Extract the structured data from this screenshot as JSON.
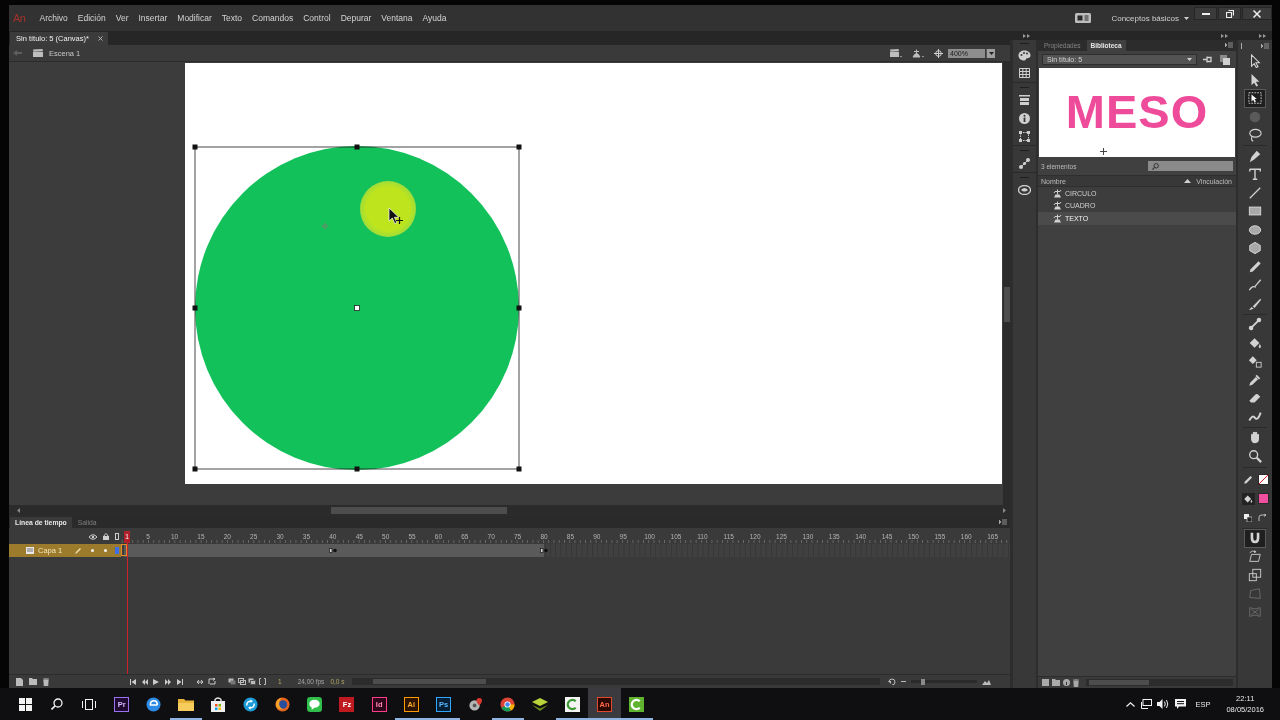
{
  "app": {
    "logo": "An"
  },
  "menu_bar": {
    "items": [
      "Archivo",
      "Edición",
      "Ver",
      "Insertar",
      "Modificar",
      "Texto",
      "Comandos",
      "Control",
      "Depurar",
      "Ventana",
      "Ayuda"
    ],
    "workspace": "Conceptos básicos"
  },
  "document_tabs": [
    {
      "label": "Sin título: 5 (Canvas)*",
      "selected": true
    }
  ],
  "edit_bar": {
    "scene": "Escena 1",
    "zoom": "400%"
  },
  "timeline": {
    "tabs": [
      {
        "label": "Línea de tiempo",
        "selected": true
      },
      {
        "label": "Salida",
        "selected": false
      }
    ],
    "frames": [
      {
        "label": "1",
        "selected": true,
        "keyframe": false
      },
      {
        "label": "5",
        "selected": false,
        "keyframe": false
      },
      {
        "label": "10",
        "selected": false,
        "keyframe": false
      },
      {
        "label": "15",
        "selected": false,
        "keyframe": false
      },
      {
        "label": "20",
        "selected": false,
        "keyframe": false
      },
      {
        "label": "25",
        "selected": false,
        "keyframe": false
      },
      {
        "label": "30",
        "selected": false,
        "keyframe": false
      },
      {
        "label": "35",
        "selected": false,
        "keyframe": false
      },
      {
        "label": "40",
        "selected": false,
        "keyframe": true
      },
      {
        "label": "45",
        "selected": false,
        "keyframe": false
      },
      {
        "label": "50",
        "selected": false,
        "keyframe": false
      },
      {
        "label": "55",
        "selected": false,
        "keyframe": false
      },
      {
        "label": "60",
        "selected": false,
        "keyframe": false
      },
      {
        "label": "65",
        "selected": false,
        "keyframe": false
      },
      {
        "label": "70",
        "selected": false,
        "keyframe": false
      },
      {
        "label": "75",
        "selected": false,
        "keyframe": false
      },
      {
        "label": "80",
        "selected": false,
        "keyframe": true
      },
      {
        "label": "85",
        "selected": false,
        "keyframe": false
      },
      {
        "label": "90",
        "selected": false,
        "keyframe": false
      },
      {
        "label": "95",
        "selected": false,
        "keyframe": false
      },
      {
        "label": "100",
        "selected": false,
        "keyframe": false
      },
      {
        "label": "105",
        "selected": false,
        "keyframe": false
      },
      {
        "label": "110",
        "selected": false,
        "keyframe": false
      },
      {
        "label": "115",
        "selected": false,
        "keyframe": false
      },
      {
        "label": "120",
        "selected": false,
        "keyframe": false
      },
      {
        "label": "125",
        "selected": false,
        "keyframe": false
      },
      {
        "label": "130",
        "selected": false,
        "keyframe": false
      },
      {
        "label": "135",
        "selected": false,
        "keyframe": false
      },
      {
        "label": "140",
        "selected": false,
        "keyframe": false
      },
      {
        "label": "145",
        "selected": false,
        "keyframe": false
      },
      {
        "label": "150",
        "selected": false,
        "keyframe": false
      },
      {
        "label": "155",
        "selected": false,
        "keyframe": false
      },
      {
        "label": "160",
        "selected": false,
        "keyframe": false
      },
      {
        "label": "165",
        "selected": false,
        "keyframe": false
      }
    ],
    "layers": [
      {
        "name": "Capa 1",
        "selected": true,
        "visible": true,
        "locked": false,
        "color": "#3f6fe8"
      }
    ],
    "footer": {
      "frame": "1",
      "fps": "24,00 fps",
      "time": "0,0 s"
    }
  },
  "library_panel": {
    "tabs": [
      {
        "label": "Propiedades",
        "selected": false
      },
      {
        "label": "Biblioteca",
        "selected": true
      }
    ],
    "library": "Sin título: 5",
    "preview_text": "MESO",
    "count": "3 elementos",
    "columns": [
      "Nombre",
      "Vinculación"
    ],
    "items": [
      {
        "name": "CIRCULO",
        "selected": false
      },
      {
        "name": "CUADRO",
        "selected": false
      },
      {
        "name": "TEXTO",
        "selected": true
      }
    ]
  },
  "tools": {
    "groups": [
      {
        "items": [
          {
            "kind": "selection",
            "selected": false,
            "disabled": false
          },
          {
            "kind": "subselection",
            "selected": false,
            "disabled": false
          },
          {
            "kind": "free-transform",
            "selected": true,
            "disabled": false
          },
          {
            "kind": "gradient-transform",
            "selected": false,
            "disabled": true
          },
          {
            "kind": "lasso",
            "selected": false,
            "disabled": false
          }
        ]
      },
      {
        "items": [
          {
            "kind": "pen",
            "selected": false,
            "disabled": false
          },
          {
            "kind": "text",
            "selected": false,
            "disabled": false
          },
          {
            "kind": "line",
            "selected": false,
            "disabled": false
          },
          {
            "kind": "rectangle",
            "selected": false,
            "disabled": false
          },
          {
            "kind": "oval",
            "selected": false,
            "disabled": false
          },
          {
            "kind": "polystar",
            "selected": false,
            "disabled": false
          },
          {
            "kind": "pencil",
            "selected": false,
            "disabled": false
          },
          {
            "kind": "paint-brush",
            "selected": false,
            "disabled": false
          },
          {
            "kind": "brush",
            "selected": false,
            "disabled": false
          }
        ]
      },
      {
        "items": [
          {
            "kind": "bone",
            "selected": false,
            "disabled": false
          },
          {
            "kind": "paint-bucket",
            "selected": false,
            "disabled": false
          },
          {
            "kind": "ink-bottle",
            "selected": false,
            "disabled": false
          },
          {
            "kind": "eyedropper",
            "selected": false,
            "disabled": false
          },
          {
            "kind": "eraser",
            "selected": false,
            "disabled": false
          },
          {
            "kind": "width",
            "selected": false,
            "disabled": false
          }
        ]
      },
      {
        "items": [
          {
            "kind": "hand",
            "selected": false,
            "disabled": false
          },
          {
            "kind": "zoom",
            "selected": false,
            "disabled": false
          }
        ]
      }
    ],
    "swatches": [
      {
        "kind": "stroke"
      },
      {
        "kind": "fill",
        "color": "#f04e9e"
      }
    ],
    "options": [
      {
        "kind": "snap",
        "selected": true,
        "disabled": false
      },
      {
        "kind": "rotate-skew",
        "selected": false,
        "disabled": false
      },
      {
        "kind": "scale",
        "selected": false,
        "disabled": false
      },
      {
        "kind": "distort",
        "selected": false,
        "disabled": true
      },
      {
        "kind": "envelope",
        "selected": false,
        "disabled": true
      }
    ]
  },
  "taskbar": {
    "apps": [
      {
        "kind": "premiere",
        "label": "Pr",
        "running": false,
        "selected": false
      },
      {
        "kind": "edge",
        "running": false,
        "selected": false
      },
      {
        "kind": "explorer",
        "running": true,
        "selected": false
      },
      {
        "kind": "store",
        "running": false,
        "selected": false
      },
      {
        "kind": "sync",
        "running": false,
        "selected": false
      },
      {
        "kind": "firefox",
        "running": false,
        "selected": false
      },
      {
        "kind": "line",
        "running": false,
        "selected": false
      },
      {
        "kind": "filezilla",
        "label": "Fz",
        "running": false,
        "selected": false
      },
      {
        "kind": "indesign",
        "label": "Id",
        "running": false,
        "selected": false
      },
      {
        "kind": "illustrator",
        "label": "Ai",
        "running": true,
        "selected": false
      },
      {
        "kind": "photoshop",
        "label": "Ps",
        "running": true,
        "selected": false
      },
      {
        "kind": "maps",
        "running": false,
        "selected": false
      },
      {
        "kind": "chrome",
        "running": true,
        "selected": false
      },
      {
        "kind": "layers",
        "running": false,
        "selected": false
      },
      {
        "kind": "camtasia",
        "running": true,
        "selected": false
      },
      {
        "kind": "animate",
        "label": "An",
        "running": true,
        "selected": true
      },
      {
        "kind": "recorder",
        "running": true,
        "selected": false
      }
    ],
    "language": "ESP",
    "time": "22:11",
    "date": "08/05/2016"
  }
}
